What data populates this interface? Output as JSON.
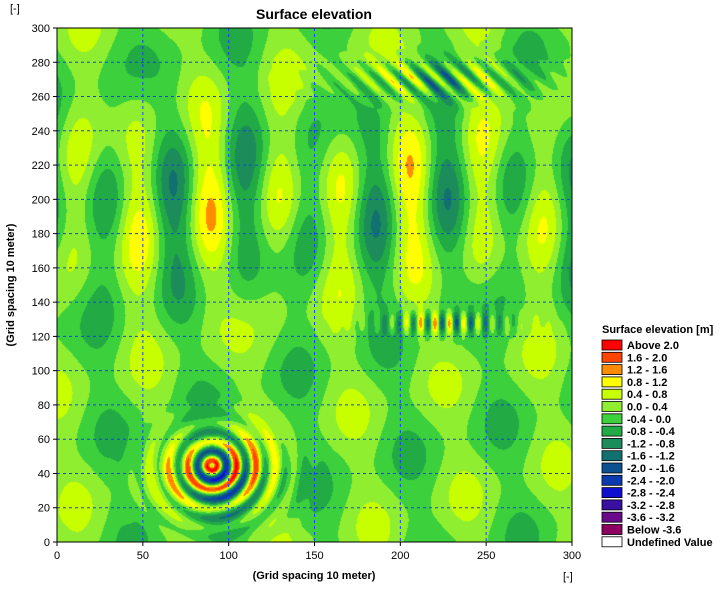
{
  "chart_data": {
    "type": "heatmap",
    "title": "Surface elevation",
    "xlabel": "(Grid spacing 10 meter)",
    "ylabel": "(Grid spacing 10 meter)",
    "x_unit": "[-]",
    "y_unit": "[-]",
    "xlim": [
      0,
      300
    ],
    "ylim": [
      0,
      300
    ],
    "x_ticks": [
      0,
      50,
      100,
      150,
      200,
      250,
      300
    ],
    "y_ticks": [
      0,
      20,
      40,
      60,
      80,
      100,
      120,
      140,
      160,
      180,
      200,
      220,
      240,
      260,
      280,
      300
    ],
    "grid": true,
    "legend_position": "right",
    "legend": {
      "title": "Surface elevation [m]",
      "entries": [
        {
          "label": "Above  2.0",
          "color": "#ff0000"
        },
        {
          "label": "1.6 -  2.0",
          "color": "#ff4500"
        },
        {
          "label": "1.2 -  1.6",
          "color": "#ff8c00"
        },
        {
          "label": "0.8 -  1.2",
          "color": "#ffff00"
        },
        {
          "label": "0.4 -  0.8",
          "color": "#c8ff00"
        },
        {
          "label": "0.0 -  0.4",
          "color": "#90ee30"
        },
        {
          "label": "-0.4 -  0.0",
          "color": "#3cd03c"
        },
        {
          "label": "-0.8 - -0.4",
          "color": "#22aa44"
        },
        {
          "label": "-1.2 - -0.8",
          "color": "#1c8c5a"
        },
        {
          "label": "-1.6 - -1.2",
          "color": "#137070"
        },
        {
          "label": "-2.0 - -1.6",
          "color": "#0d5090"
        },
        {
          "label": "-2.4 - -2.0",
          "color": "#0a3ab0"
        },
        {
          "label": "-2.8 - -2.4",
          "color": "#1010d0"
        },
        {
          "label": "-3.2 - -2.8",
          "color": "#3a10a0"
        },
        {
          "label": "-3.6 - -3.2",
          "color": "#6a0a8a"
        },
        {
          "label": "Below -3.6",
          "color": "#8b0060"
        },
        {
          "label": "Undefined Value",
          "color": "#ffffff"
        }
      ]
    }
  }
}
